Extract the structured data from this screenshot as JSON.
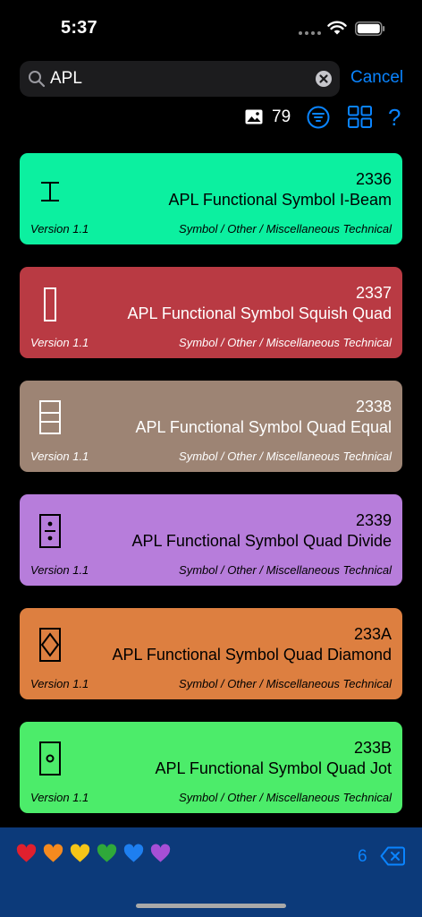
{
  "status": {
    "time": "5:37"
  },
  "search": {
    "query": "APL",
    "cancel_label": "Cancel"
  },
  "toolbar": {
    "count": "79"
  },
  "cards": [
    {
      "code": "2336",
      "name": "APL Functional Symbol I-Beam",
      "version": "Version 1.1",
      "category": "Symbol / Other / Miscellaneous Technical",
      "color": "#0cf0a0",
      "glyph": "i-beam"
    },
    {
      "code": "2337",
      "name": "APL Functional Symbol Squish Quad",
      "version": "Version 1.1",
      "category": "Symbol / Other / Miscellaneous Technical",
      "color": "#b93a43",
      "glyph": "squish-quad"
    },
    {
      "code": "2338",
      "name": "APL Functional Symbol Quad Equal",
      "version": "Version 1.1",
      "category": "Symbol / Other / Miscellaneous Technical",
      "color": "#9d8474",
      "glyph": "quad-equal"
    },
    {
      "code": "2339",
      "name": "APL Functional Symbol Quad Divide",
      "version": "Version 1.1",
      "category": "Symbol / Other / Miscellaneous Technical",
      "color": "#b77ddb",
      "glyph": "quad-divide"
    },
    {
      "code": "233A",
      "name": "APL Functional Symbol Quad Diamond",
      "version": "Version 1.1",
      "category": "Symbol / Other / Miscellaneous Technical",
      "color": "#dd7f40",
      "glyph": "quad-diamond"
    },
    {
      "code": "233B",
      "name": "APL Functional Symbol Quad Jot",
      "version": "Version 1.1",
      "category": "Symbol / Other / Miscellaneous Technical",
      "color": "#4cec6a",
      "glyph": "quad-jot"
    }
  ],
  "bottom": {
    "hearts": [
      {
        "name": "red-heart",
        "color": "#e0202e"
      },
      {
        "name": "orange-heart",
        "color": "#f58a1f"
      },
      {
        "name": "yellow-heart",
        "color": "#f5c518"
      },
      {
        "name": "green-heart",
        "color": "#2fa83a"
      },
      {
        "name": "blue-heart",
        "color": "#1e7ff0"
      },
      {
        "name": "purple-heart",
        "color": "#a64fd6"
      }
    ],
    "selection_count": "6"
  },
  "colors": {
    "accent": "#0a84ff",
    "panel": "#0c3a7a",
    "search_bg": "#1c1c1e"
  }
}
